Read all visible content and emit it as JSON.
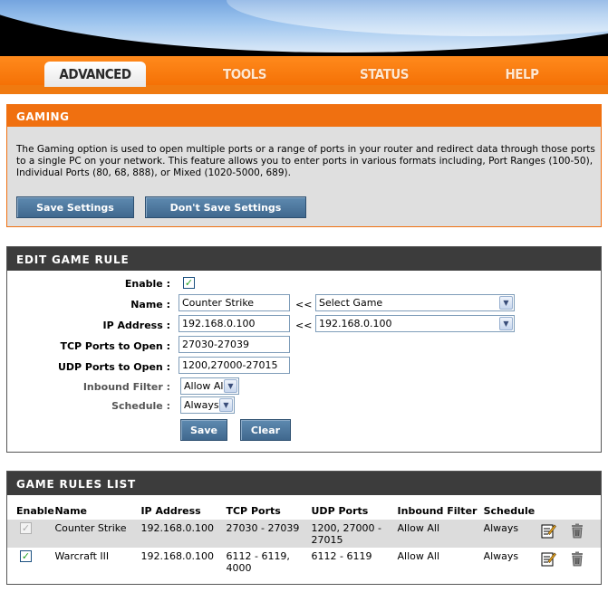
{
  "nav": {
    "tabs": [
      {
        "label": "ADVANCED",
        "active": true
      },
      {
        "label": "TOOLS",
        "active": false
      },
      {
        "label": "STATUS",
        "active": false
      },
      {
        "label": "HELP",
        "active": false
      }
    ]
  },
  "gaming": {
    "title": "GAMING",
    "description": "The Gaming option is used to open multiple ports or a range of ports in your router and redirect data through those ports to a single PC on your network. This feature allows you to enter ports in various formats including, Port Ranges (100-50), Individual Ports (80, 68, 888), or Mixed (1020-5000, 689).",
    "save_label": "Save Settings",
    "dont_save_label": "Don't Save Settings"
  },
  "edit": {
    "title": "EDIT GAME RULE",
    "enable_label": "Enable :",
    "enable_checked": true,
    "name_label": "Name :",
    "name_value": "Counter Strike",
    "copy_arrow": "<<",
    "game_select": "Select Game",
    "ip_label": "IP Address :",
    "ip_value": "192.168.0.100",
    "ip_select": "192.168.0.100",
    "tcp_label": "TCP Ports to Open :",
    "tcp_value": "27030-27039",
    "udp_label": "UDP Ports to Open :",
    "udp_value": "1200,27000-27015",
    "inbound_label": "Inbound Filter :",
    "inbound_value": "Allow All",
    "schedule_label": "Schedule :",
    "schedule_value": "Always",
    "save_label": "Save",
    "clear_label": "Clear"
  },
  "list": {
    "title": "GAME RULES LIST",
    "headers": [
      "Enable",
      "Name",
      "IP Address",
      "TCP Ports",
      "UDP Ports",
      "Inbound Filter",
      "Schedule"
    ],
    "rows": [
      {
        "enabled": true,
        "editing": true,
        "name": "Counter Strike",
        "ip": "192.168.0.100",
        "tcp": "27030 - 27039",
        "udp": "1200, 27000 - 27015",
        "inbound": "Allow All",
        "schedule": "Always"
      },
      {
        "enabled": true,
        "editing": false,
        "name": "Warcraft III",
        "ip": "192.168.0.100",
        "tcp": "6112 - 6119, 4000",
        "udp": "6112 - 6119",
        "inbound": "Allow All",
        "schedule": "Always"
      }
    ]
  },
  "icons": {
    "edit": "edit-note-icon",
    "delete": "trash-icon",
    "check": "checkmark-icon",
    "dropdown": "chevron-down-icon"
  },
  "colors": {
    "accent_orange": "#f07010",
    "section_dark": "#3c3c3c",
    "button_blue": "#4a7399"
  }
}
